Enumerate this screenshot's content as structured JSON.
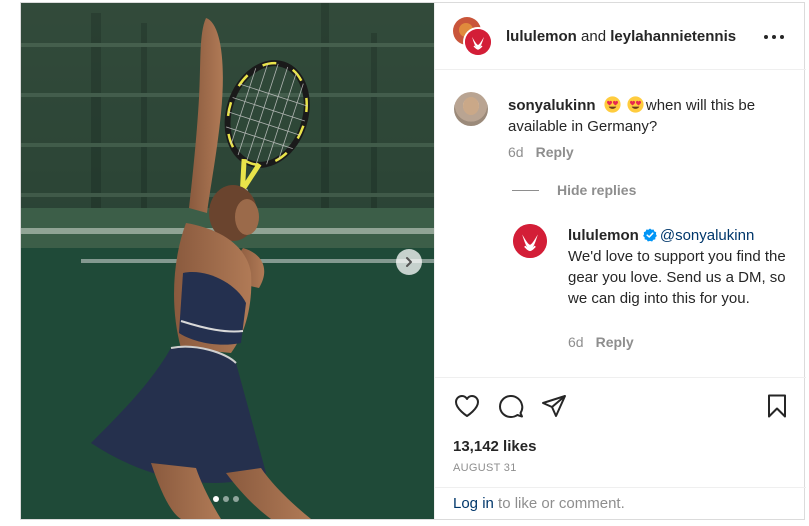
{
  "header": {
    "author_primary": "lululemon",
    "joiner": "and",
    "author_secondary": "leylahannietennis",
    "more_icon": "more-horizontal-icon"
  },
  "comment": {
    "username": "sonyalukinn",
    "emojis": [
      "heart-eyes-emoji",
      "heart-eyes-emoji"
    ],
    "text": "when will this be available in Germany?",
    "age": "6d",
    "reply_label": "Reply"
  },
  "thread": {
    "hide_label": "Hide replies"
  },
  "reply": {
    "username": "lululemon",
    "verified_icon": "verified-badge-icon",
    "mention": "@sonyalukinn",
    "text": "We'd love to support you find the gear you love. Send us a DM, so we can dig into this for you.",
    "age": "6d",
    "reply_label": "Reply"
  },
  "actions": {
    "icons": [
      "heart-icon",
      "comment-icon",
      "share-icon",
      "bookmark-icon"
    ],
    "likes": "13,142 likes",
    "date": "AUGUST 31"
  },
  "login": {
    "link": "Log in",
    "rest": " to like or comment."
  },
  "carousel": {
    "dot_count": 3,
    "active_index": 0,
    "next_icon": "chevron-right-icon"
  },
  "colors": {
    "brand_red": "#d31e37",
    "link_blue": "#00376b",
    "verified_blue": "#0095f6",
    "muted": "#8e8e8e"
  }
}
